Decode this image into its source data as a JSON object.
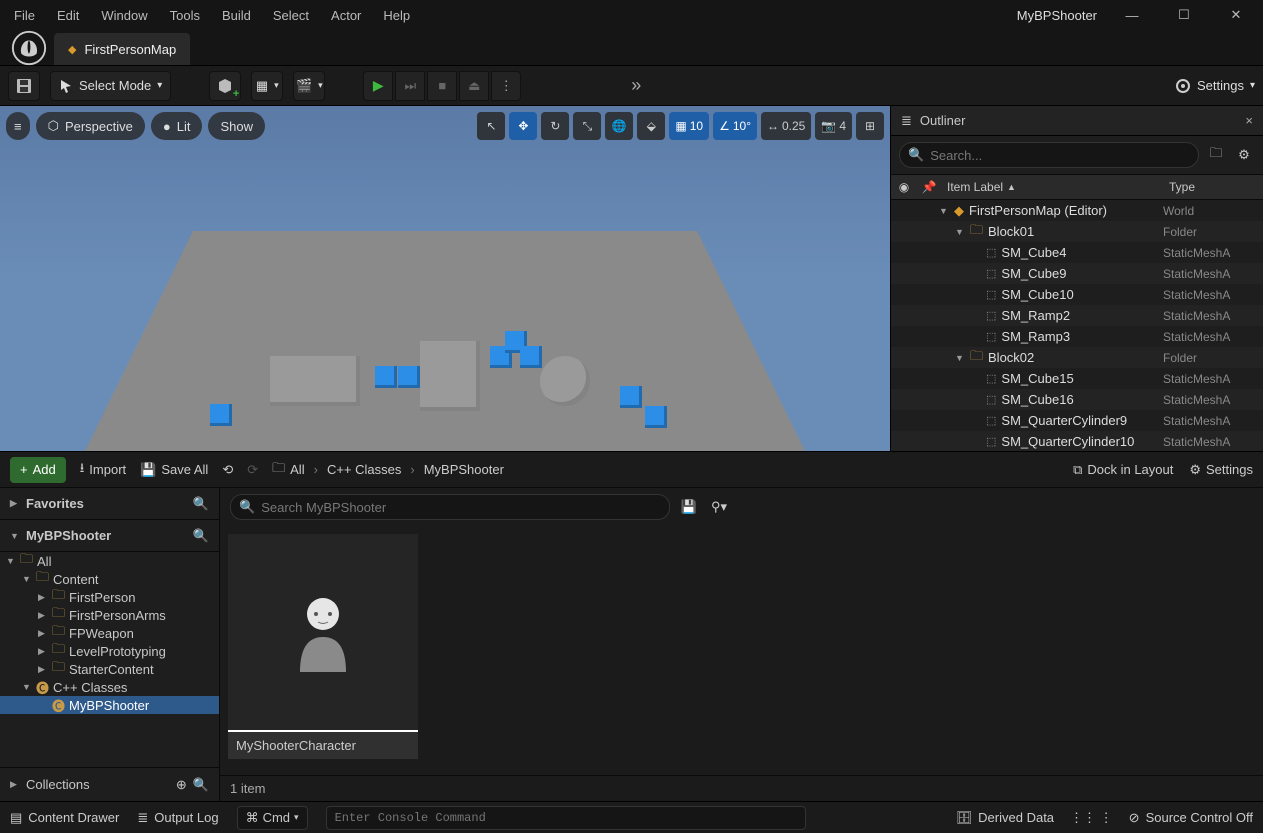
{
  "project_name": "MyBPShooter",
  "menus": [
    "File",
    "Edit",
    "Window",
    "Tools",
    "Build",
    "Select",
    "Actor",
    "Help"
  ],
  "tab_map": "FirstPersonMap",
  "toolbar": {
    "mode_label": "Select Mode",
    "settings_label": "Settings"
  },
  "viewport": {
    "hamburger": "≡",
    "perspective": "Perspective",
    "lit": "Lit",
    "show": "Show",
    "grid_snap": "10",
    "angle_snap": "10°",
    "scale_snap": "0.25",
    "cam_speed": "4"
  },
  "outliner": {
    "title": "Outliner",
    "search_placeholder": "Search...",
    "col_label": "Item Label",
    "col_type": "Type",
    "rows": [
      {
        "indent": 0,
        "caret": "▼",
        "icon": "level",
        "label": "FirstPersonMap (Editor)",
        "type": "World"
      },
      {
        "indent": 1,
        "caret": "▼",
        "icon": "folder",
        "label": "Block01",
        "type": "Folder"
      },
      {
        "indent": 2,
        "caret": "",
        "icon": "mesh",
        "label": "SM_Cube4",
        "type": "StaticMeshA"
      },
      {
        "indent": 2,
        "caret": "",
        "icon": "mesh",
        "label": "SM_Cube9",
        "type": "StaticMeshA"
      },
      {
        "indent": 2,
        "caret": "",
        "icon": "mesh",
        "label": "SM_Cube10",
        "type": "StaticMeshA"
      },
      {
        "indent": 2,
        "caret": "",
        "icon": "mesh",
        "label": "SM_Ramp2",
        "type": "StaticMeshA"
      },
      {
        "indent": 2,
        "caret": "",
        "icon": "mesh",
        "label": "SM_Ramp3",
        "type": "StaticMeshA"
      },
      {
        "indent": 1,
        "caret": "▼",
        "icon": "folder",
        "label": "Block02",
        "type": "Folder"
      },
      {
        "indent": 2,
        "caret": "",
        "icon": "mesh",
        "label": "SM_Cube15",
        "type": "StaticMeshA"
      },
      {
        "indent": 2,
        "caret": "",
        "icon": "mesh",
        "label": "SM_Cube16",
        "type": "StaticMeshA"
      },
      {
        "indent": 2,
        "caret": "",
        "icon": "mesh",
        "label": "SM_QuarterCylinder9",
        "type": "StaticMeshA"
      },
      {
        "indent": 2,
        "caret": "",
        "icon": "mesh",
        "label": "SM_QuarterCylinder10",
        "type": "StaticMeshA"
      }
    ]
  },
  "cb": {
    "add_label": "Add",
    "import_label": "Import",
    "save_all_label": "Save All",
    "breadcrumb": [
      "All",
      "C++ Classes",
      "MyBPShooter"
    ],
    "dock_label": "Dock in Layout",
    "settings_label": "Settings",
    "favorites": "Favorites",
    "proj": "MyBPShooter",
    "tree": [
      {
        "indent": 0,
        "caret": "▼",
        "icon": "folder",
        "label": "All",
        "sel": false
      },
      {
        "indent": 1,
        "caret": "▼",
        "icon": "folder",
        "label": "Content",
        "sel": false
      },
      {
        "indent": 2,
        "caret": "▶",
        "icon": "folder",
        "label": "FirstPerson",
        "sel": false
      },
      {
        "indent": 2,
        "caret": "▶",
        "icon": "folder",
        "label": "FirstPersonArms",
        "sel": false
      },
      {
        "indent": 2,
        "caret": "▶",
        "icon": "folder",
        "label": "FPWeapon",
        "sel": false
      },
      {
        "indent": 2,
        "caret": "▶",
        "icon": "folder",
        "label": "LevelPrototyping",
        "sel": false
      },
      {
        "indent": 2,
        "caret": "▶",
        "icon": "folder",
        "label": "StarterContent",
        "sel": false
      },
      {
        "indent": 1,
        "caret": "▼",
        "icon": "cpp",
        "label": "C++ Classes",
        "sel": false
      },
      {
        "indent": 2,
        "caret": "",
        "icon": "cpp",
        "label": "MyBPShooter",
        "sel": true
      }
    ],
    "collections": "Collections",
    "search_placeholder": "Search MyBPShooter",
    "asset_name": "MyShooterCharacter",
    "status": "1 item"
  },
  "statusbar": {
    "content_drawer": "Content Drawer",
    "output_log": "Output Log",
    "cmd_label": "Cmd",
    "cmd_placeholder": "Enter Console Command",
    "derived_data": "Derived Data",
    "source_control": "Source Control Off"
  }
}
